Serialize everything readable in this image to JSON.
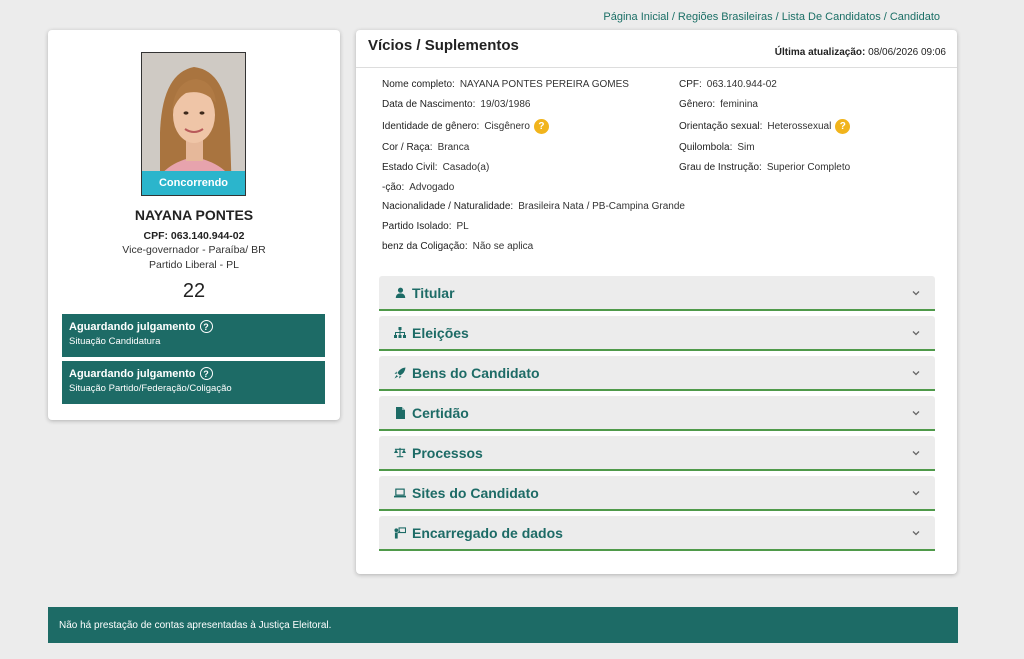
{
  "breadcrumb": [
    "Página Inicial",
    "Regiões Brasileiras",
    "Lista De Candidatos",
    "Candidato"
  ],
  "candidate": {
    "photo_badge": "Concorrendo",
    "name": "NAYANA PONTES",
    "cpf": "CPF: 063.140.944-02",
    "office": "Vice-governador - Paraíba/ BR",
    "party": "Partido Liberal - PL",
    "number": "22"
  },
  "status": [
    {
      "title": "Aguardando julgamento",
      "subtitle": "Situação Candidatura"
    },
    {
      "title": "Aguardando julgamento",
      "subtitle": "Situação Partido/Federação/Coligação"
    }
  ],
  "details": {
    "title": "Vícios / Suplementos",
    "update_label": "Última atualização:",
    "update_value": "08/06/2026 09:06",
    "fields": {
      "nome": {
        "label": "Nome completo:",
        "value": "NAYANA PONTES PEREIRA GOMES"
      },
      "cpf": {
        "label": "CPF:",
        "value": "063.140.944-02"
      },
      "nascimento": {
        "label": "Data de Nascimento:",
        "value": "19/03/1986"
      },
      "genero": {
        "label": "Gênero:",
        "value": "feminina"
      },
      "identidade": {
        "label": "Identidade de gênero:",
        "value": "Cisgênero"
      },
      "orientacao": {
        "label": "Orientação sexual:",
        "value": "Heterossexual"
      },
      "cor": {
        "label": "Cor / Raça:",
        "value": "Branca"
      },
      "quilombola": {
        "label": "Quilombola:",
        "value": "Sim"
      },
      "estado_civil": {
        "label": "Estado Civil:",
        "value": "Casado(a)"
      },
      "instrucao": {
        "label": "Grau de Instrução:",
        "value": "Superior Completo"
      },
      "ocupacao": {
        "label": "-ção:",
        "value": "Advogado"
      },
      "nacionalidade": {
        "label": "Nacionalidade / Naturalidade:",
        "value": "Brasileira Nata / PB-Campina Grande"
      },
      "partido": {
        "label": "Partido Isolado:",
        "value": "PL"
      },
      "coligacao": {
        "label": "benz da Coligação:",
        "value": "Não se aplica"
      }
    }
  },
  "accordion": [
    {
      "label": "Titular",
      "icon": "person-icon"
    },
    {
      "label": "Eleições",
      "icon": "sitemap-icon"
    },
    {
      "label": "Bens do Candidato",
      "icon": "rocket-icon"
    },
    {
      "label": "Certidão",
      "icon": "file-icon"
    },
    {
      "label": "Processos",
      "icon": "scale-icon"
    },
    {
      "label": "Sites do Candidato",
      "icon": "laptop-icon"
    },
    {
      "label": "Encarregado de dados",
      "icon": "person-board-icon"
    }
  ],
  "footer": "Não há prestação de contas apresentadas à Justiça Eleitoral.",
  "colors": {
    "teal": "#1d6b66",
    "cyan": "#2bb5cc",
    "green_line": "#4f9a4a",
    "help_yellow": "#f1b41c"
  }
}
